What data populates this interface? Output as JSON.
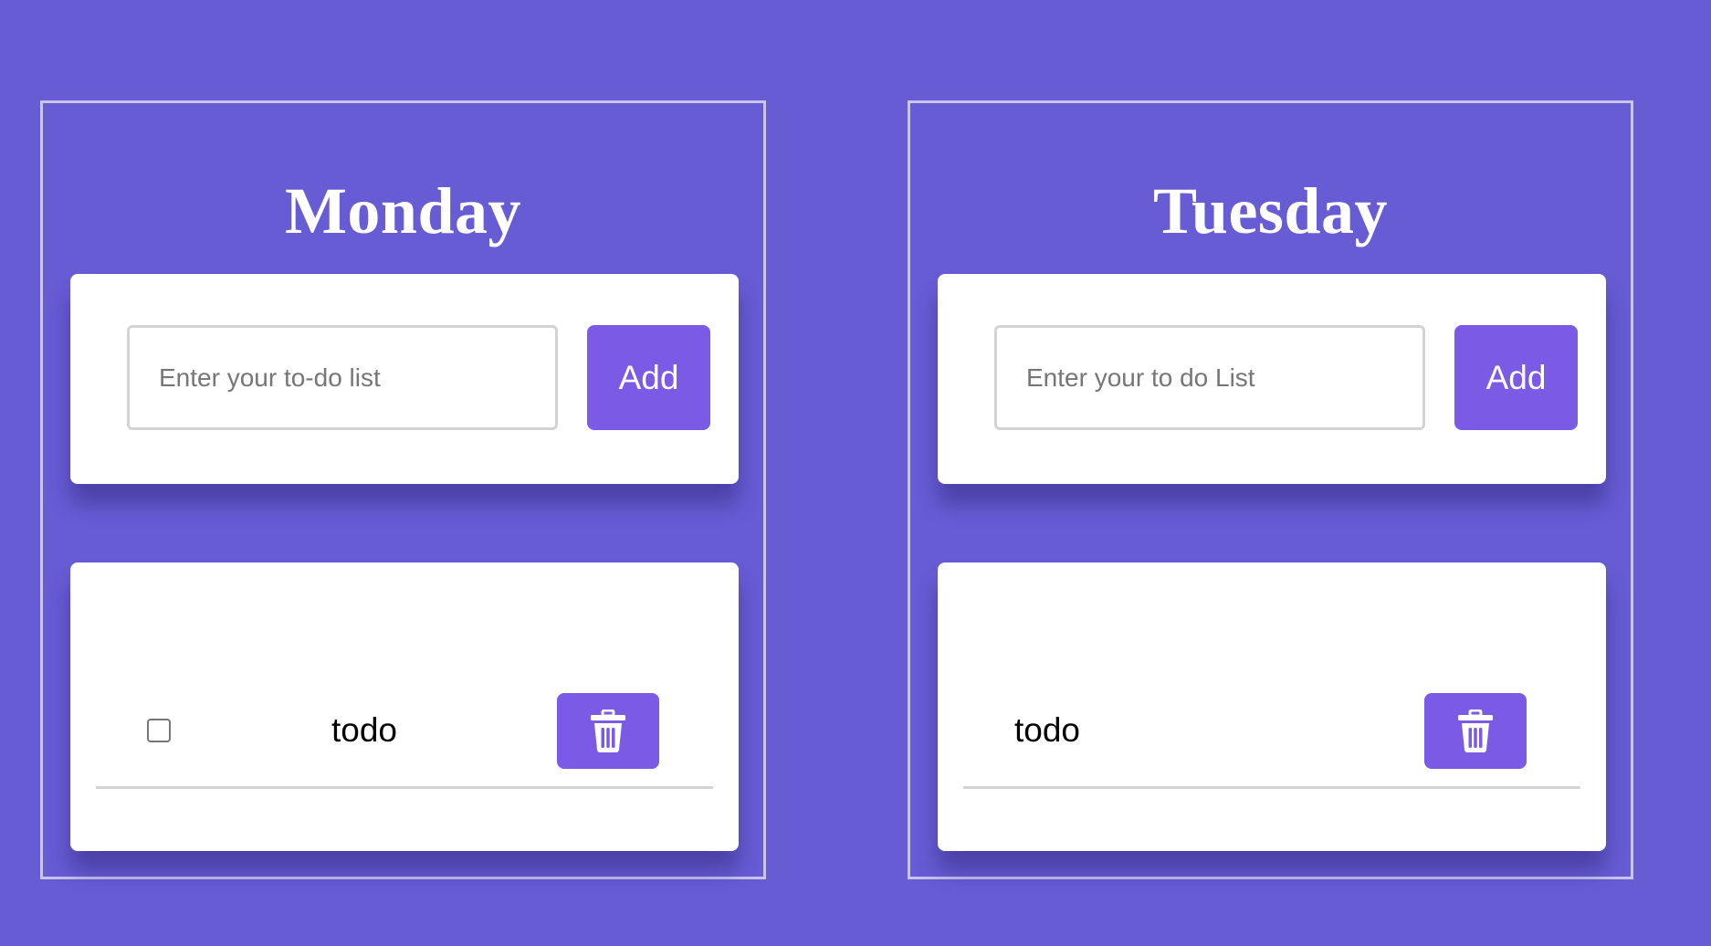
{
  "days": [
    {
      "title": "Monday",
      "input": {
        "value": "",
        "placeholder": "Enter your to-do list"
      },
      "add_label": "Add",
      "items": [
        {
          "text": "todo",
          "has_checkbox": true,
          "checked": false,
          "delete_icon": "trash-icon"
        }
      ]
    },
    {
      "title": "Tuesday",
      "input": {
        "value": "",
        "placeholder": "Enter your to do List"
      },
      "add_label": "Add",
      "items": [
        {
          "text": "todo",
          "has_checkbox": false,
          "delete_icon": "trash-icon"
        }
      ]
    }
  ],
  "colors": {
    "background": "#685cd5",
    "accent": "#7b5ae6",
    "card": "#ffffff",
    "border": "#c8c4ee",
    "divider": "#d3d3d3"
  }
}
